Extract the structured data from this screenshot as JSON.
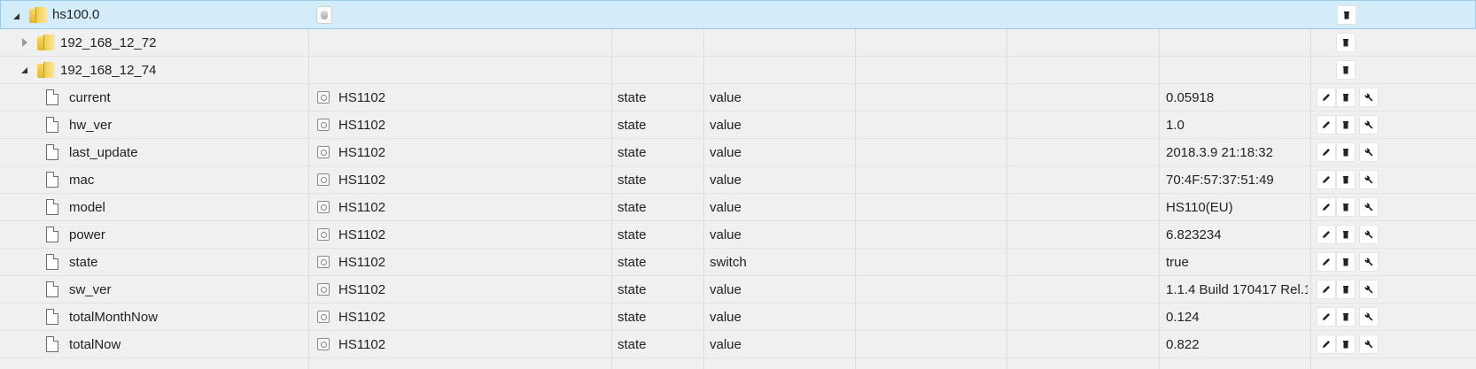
{
  "tree": {
    "root": {
      "name": "hs100.0"
    },
    "devices": [
      {
        "name": "192_168_12_72",
        "expanded": false
      },
      {
        "name": "192_168_12_74",
        "expanded": true
      }
    ],
    "states": [
      {
        "id": "current",
        "device": "HS1102",
        "type": "state",
        "role": "value",
        "val": "0.05918"
      },
      {
        "id": "hw_ver",
        "device": "HS1102",
        "type": "state",
        "role": "value",
        "val": "1.0"
      },
      {
        "id": "last_update",
        "device": "HS1102",
        "type": "state",
        "role": "value",
        "val": "2018.3.9 21:18:32"
      },
      {
        "id": "mac",
        "device": "HS1102",
        "type": "state",
        "role": "value",
        "val": "70:4F:57:37:51:49"
      },
      {
        "id": "model",
        "device": "HS1102",
        "type": "state",
        "role": "value",
        "val": "HS110(EU)"
      },
      {
        "id": "power",
        "device": "HS1102",
        "type": "state",
        "role": "value",
        "val": "6.823234"
      },
      {
        "id": "state",
        "device": "HS1102",
        "type": "state",
        "role": "switch",
        "val": "true"
      },
      {
        "id": "sw_ver",
        "device": "HS1102",
        "type": "state",
        "role": "value",
        "val": "1.1.4 Build 170417 Rel.1"
      },
      {
        "id": "totalMonthNow",
        "device": "HS1102",
        "type": "state",
        "role": "value",
        "val": "0.124"
      },
      {
        "id": "totalNow",
        "device": "HS1102",
        "type": "state",
        "role": "value",
        "val": "0.822"
      }
    ]
  },
  "icons": {
    "edit": "pencil-icon",
    "delete": "trash-icon",
    "settings": "wrench-icon",
    "folder": "folder-icon",
    "file": "file-icon"
  },
  "colors": {
    "selected_row": "#d3ecf9",
    "selected_border": "#9ccbea",
    "row_bg": "#f0f0f0"
  }
}
